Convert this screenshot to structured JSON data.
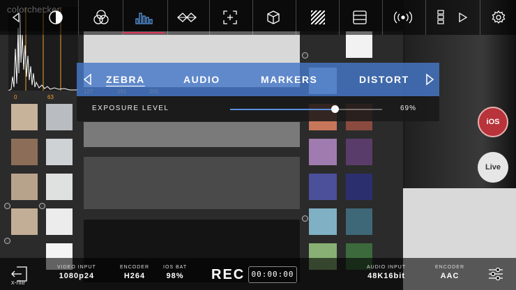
{
  "app": {
    "logo_text": "colorchecker",
    "brand_mark": "x-rite"
  },
  "toolbar": {
    "items": [
      {
        "name": "back-icon"
      },
      {
        "name": "contrast-icon"
      },
      {
        "name": "color-wheels-icon"
      },
      {
        "name": "histogram-icon",
        "active": true
      },
      {
        "name": "waveform-icon"
      },
      {
        "name": "focus-assist-icon"
      },
      {
        "name": "3d-cube-icon"
      },
      {
        "name": "zebra-stripes-icon"
      },
      {
        "name": "list-icon"
      },
      {
        "name": "signal-icon"
      },
      {
        "name": "film-icon"
      },
      {
        "name": "play-icon"
      },
      {
        "name": "settings-icon"
      }
    ],
    "accent": "#e0335a"
  },
  "histogram": {
    "ticks": [
      "0",
      "63"
    ],
    "ticks_row2": [
      "127",
      "191",
      "255"
    ],
    "accent": "#f0a030"
  },
  "zebra_menu": {
    "tabs": [
      "ZEBRA",
      "AUDIO",
      "MARKERS",
      "DISTORT"
    ],
    "active_tab": "ZEBRA",
    "exposure_label": "EXPOSURE LEVEL",
    "exposure_value": "69%",
    "exposure_fraction": 0.69,
    "panel_color": "#4678c8"
  },
  "side_buttons": {
    "ios_label": "iOS",
    "live_label": "Live"
  },
  "bottom_bar": {
    "video_input": {
      "label": "VIDEO INPUT",
      "value": "1080p24"
    },
    "encoder": {
      "label": "ENCODER",
      "value": "H264"
    },
    "ios_bat": {
      "label": "IOS BAT",
      "value": "98%"
    },
    "rec_label": "REC",
    "timecode": "00:00:00",
    "audio_input": {
      "label": "AUDIO INPUT",
      "value": "48K16bit"
    },
    "audio_encoder": {
      "label": "ENCODER",
      "value": "AAC"
    }
  }
}
